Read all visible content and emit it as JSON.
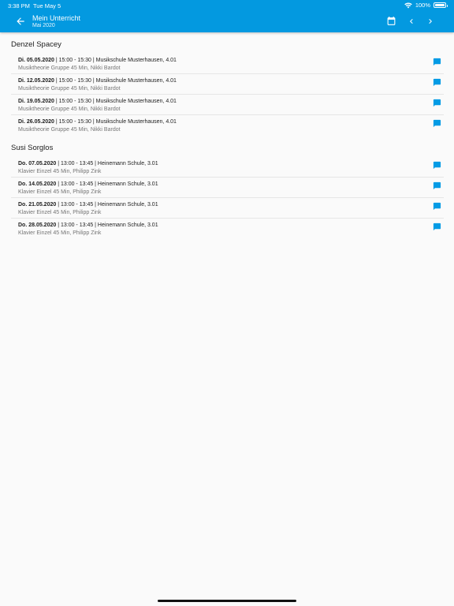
{
  "status_bar": {
    "time": "3:38 PM",
    "date": "Tue May 5",
    "battery": "100%"
  },
  "appbar": {
    "title": "Mein Unterricht",
    "subtitle": "Mai 2020",
    "color": "#0399e0"
  },
  "sections": [
    {
      "name": "Denzel Spacey",
      "lessons": [
        {
          "date": "Di. 05.05.2020",
          "info": " | 15:00 - 15:30 | Musikschule Musterhausen, 4.01",
          "detail": "Musiktheorie Gruppe 45 Min, Nikki Bardot"
        },
        {
          "date": "Di. 12.05.2020",
          "info": " | 15:00 - 15:30 | Musikschule Musterhausen, 4.01",
          "detail": "Musiktheorie Gruppe 45 Min, Nikki Bardot"
        },
        {
          "date": "Di. 19.05.2020",
          "info": " | 15:00 - 15:30 | Musikschule Musterhausen, 4.01",
          "detail": "Musiktheorie Gruppe 45 Min, Nikki Bardot"
        },
        {
          "date": "Di. 26.05.2020",
          "info": " | 15:00 - 15:30 | Musikschule Musterhausen, 4.01",
          "detail": "Musiktheorie Gruppe 45 Min, Nikki Bardot"
        }
      ]
    },
    {
      "name": "Susi Sorglos",
      "lessons": [
        {
          "date": "Do. 07.05.2020",
          "info": " | 13:00 - 13:45 | Heinemann Schule, 3.01",
          "detail": "Klavier Einzel 45 Min, Philipp Zink"
        },
        {
          "date": "Do. 14.05.2020",
          "info": " | 13:00 - 13:45 | Heinemann Schule, 3.01",
          "detail": "Klavier Einzel 45 Min, Philipp Zink"
        },
        {
          "date": "Do. 21.05.2020",
          "info": " | 13:00 - 13:45 | Heinemann Schule, 3.01",
          "detail": "Klavier Einzel 45 Min, Philipp Zink"
        },
        {
          "date": "Do. 28.05.2020",
          "info": " | 13:00 - 13:45 | Heinemann Schule, 3.01",
          "detail": "Klavier Einzel 45 Min, Philipp Zink"
        }
      ]
    }
  ],
  "icons": {
    "back": "arrow-back-icon",
    "calendar": "calendar-icon",
    "prev": "chevron-left-icon",
    "next": "chevron-right-icon",
    "comment": "chat-bubble-icon",
    "wifi": "wifi-icon",
    "battery": "battery-icon"
  },
  "accent_color": "#039be5"
}
